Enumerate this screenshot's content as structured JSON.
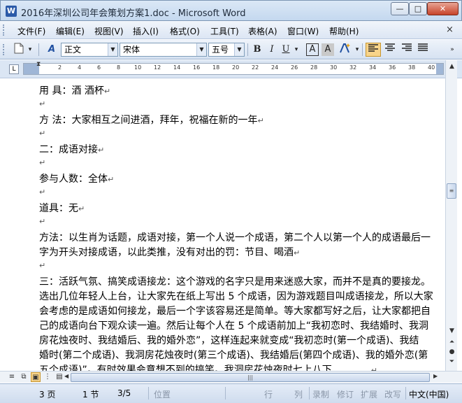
{
  "window": {
    "title": "2016年深圳公司年会策划方案1.doc - Microsoft Word",
    "controls": {
      "minimize": "—",
      "maximize": "□",
      "close": "✕"
    },
    "doc_close": "×"
  },
  "menu": {
    "items": [
      "文件(F)",
      "编辑(E)",
      "视图(V)",
      "插入(I)",
      "格式(O)",
      "工具(T)",
      "表格(A)",
      "窗口(W)",
      "帮助(H)"
    ]
  },
  "toolbar": {
    "style_value": "正文",
    "font_value": "宋体",
    "size_value": "五号",
    "style_icon": "A",
    "bold": "B",
    "italic": "I",
    "underline": "U",
    "char_border": "A",
    "char_shading": "A",
    "highlight": "A",
    "align_active": "left"
  },
  "ruler": {
    "ticks": [
      "2",
      "4",
      "6",
      "8",
      "10",
      "12",
      "14",
      "16",
      "18",
      "20",
      "22",
      "24",
      "26",
      "28",
      "30",
      "32",
      "34",
      "36",
      "38",
      "40"
    ],
    "corner": "L"
  },
  "document": {
    "lines": [
      "用  具：酒  酒杯",
      "",
      "方  法：大家相互之间进酒，拜年，祝福在新的一年",
      "",
      "二：成语对接",
      "",
      "参与人数：全体",
      "",
      "道具：无",
      "",
      "方法：以生肖为话题，成语对接，第一个人说一个成语，第二个人以第一个人的成语最后一",
      "字为开头对接成语，以此类推，没有对出的罚：节目、喝酒",
      "",
      "三：活跃气氛、搞笑成语接龙：这个游戏的名字只是用来迷惑大家，而并不是真的要接龙。",
      "选出几位年轻人上台，让大家先在纸上写出 5 个成语，因为游戏题目叫成语接龙，所以大家",
      "会考虑的是成语如何接龙，最后一个字该容易还是简单。等大家都写好之后，让大家都把自",
      "己的成语向台下观众读一遍。然后让每个人在 5 个成语前加上“我初恋时、我结婚时、我洞",
      "房花烛夜时、我结婚后、我的婚外恋”，这样连起来就变成“我初恋时(第一个成语)、我结",
      "婚时(第二个成语)、我洞房花烛夜时(第三个成语)、我结婚后(第四个成语)、我的婚外恋(第",
      "五个成语)”。有时效果会意想不到的搞笑。我洞房花烛夜时七上八下…………"
    ],
    "paragraph_mark": "↵"
  },
  "statusbar": {
    "page": "3 页",
    "section": "1 节",
    "page_of": "3/5",
    "position": "位置",
    "line": "行",
    "column": "列",
    "record": "录制",
    "revise": "修订",
    "extend": "扩展",
    "overtype": "改写",
    "language": "中文(中国)"
  }
}
